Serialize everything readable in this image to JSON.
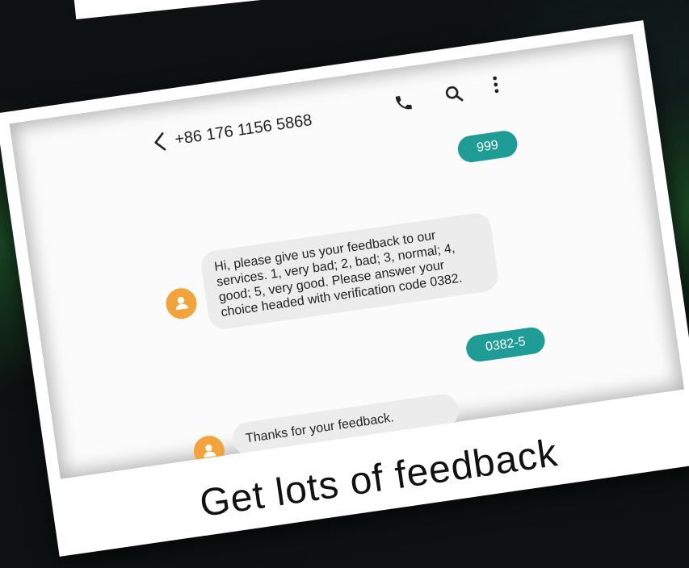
{
  "conversation": {
    "phone_number": "+86 176 1156 5868",
    "messages": [
      {
        "direction": "outgoing",
        "text": "999"
      },
      {
        "direction": "incoming",
        "text": "Hi, please give us your feedback to our services. 1, very bad; 2, bad; 3, normal; 4, good; 5, very good. Please answer your choice headed with verification code 0382."
      },
      {
        "direction": "outgoing",
        "text": "0382-5"
      },
      {
        "direction": "incoming",
        "text": "Thanks for your feedback."
      }
    ]
  },
  "header_icons": [
    "back-icon",
    "phone-icon",
    "search-icon",
    "more-icon"
  ],
  "caption": "Get lots of feedback",
  "colors": {
    "outgoing_bubble": "#1f9c95",
    "incoming_bubble": "#ececec",
    "avatar": "#f2a33c",
    "background": "#0d1111"
  }
}
